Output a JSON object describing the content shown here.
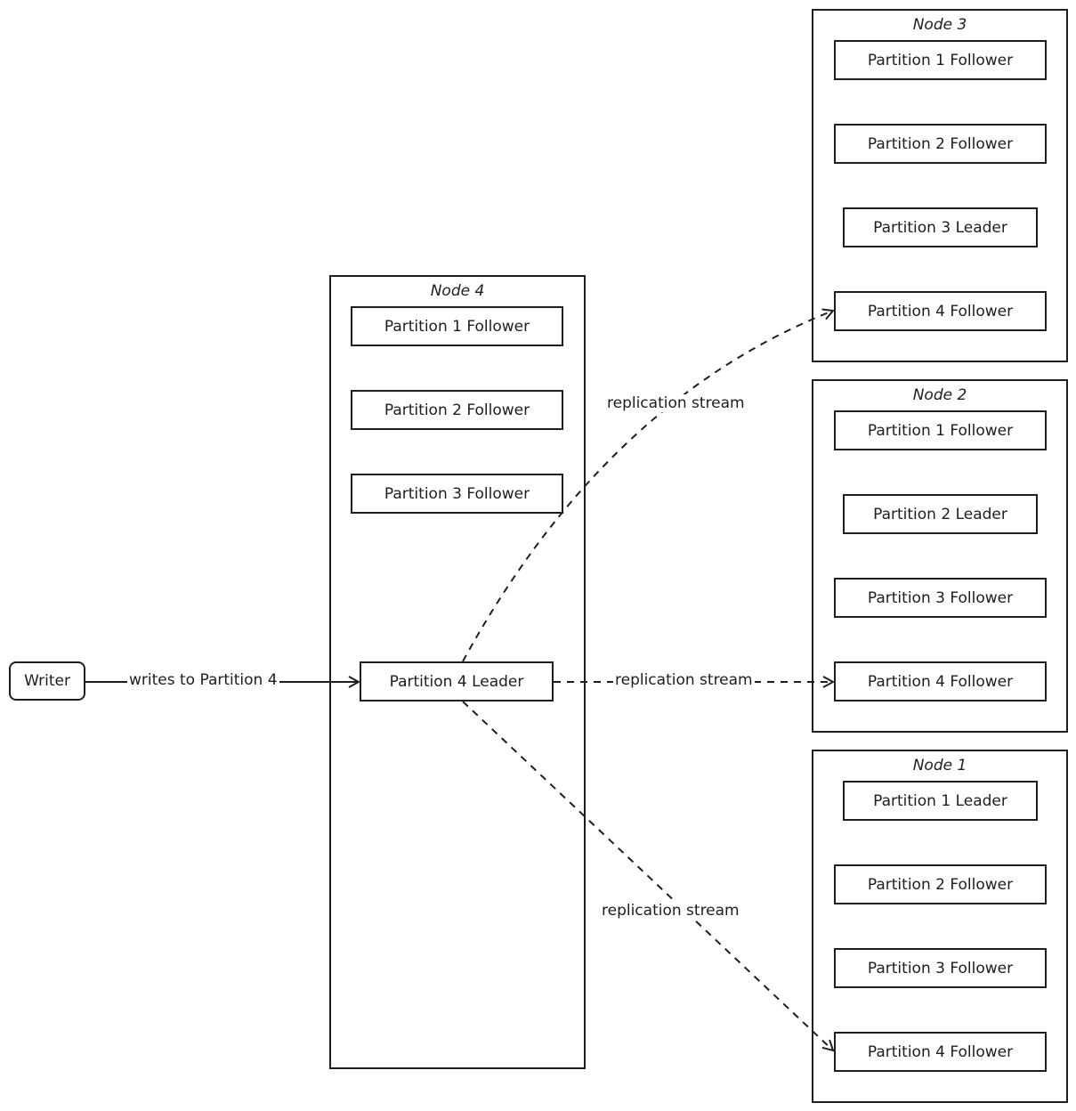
{
  "writer": {
    "label": "Writer"
  },
  "edges": {
    "write_label": "writes to Partition 4",
    "replication_label_top": "replication stream",
    "replication_label_mid": "replication stream",
    "replication_label_bottom": "replication stream"
  },
  "nodes": {
    "node4": {
      "title": "Node 4",
      "partitions": [
        "Partition 1 Follower",
        "Partition 2 Follower",
        "Partition 3 Follower",
        "Partition 4 Leader"
      ]
    },
    "node3": {
      "title": "Node 3",
      "partitions": [
        "Partition 1 Follower",
        "Partition 2 Follower",
        "Partition 3 Leader",
        "Partition 4 Follower"
      ]
    },
    "node2": {
      "title": "Node 2",
      "partitions": [
        "Partition 1 Follower",
        "Partition 2 Leader",
        "Partition 3 Follower",
        "Partition 4 Follower"
      ]
    },
    "node1": {
      "title": "Node 1",
      "partitions": [
        "Partition 1 Leader",
        "Partition 2 Follower",
        "Partition 3 Follower",
        "Partition 4 Follower"
      ]
    }
  }
}
